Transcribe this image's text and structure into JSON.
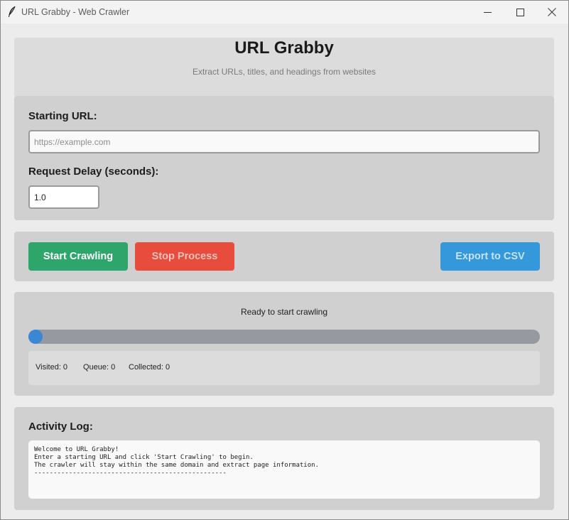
{
  "window": {
    "title": "URL Grabby - Web Crawler",
    "icon": "feather-icon"
  },
  "header": {
    "title": "URL Grabby",
    "subtitle": "Extract URLs, titles, and headings from websites"
  },
  "form": {
    "url_label": "Starting URL:",
    "url_placeholder": "https://example.com",
    "url_value": "",
    "delay_label": "Request Delay (seconds):",
    "delay_value": "1.0"
  },
  "actions": {
    "start_label": "Start Crawling",
    "stop_label": "Stop Process",
    "export_label": "Export to CSV"
  },
  "progress": {
    "status": "Ready to start crawling",
    "value": 0,
    "visited": "Visited: 0",
    "queue": "Queue: 0",
    "collected": "Collected: 0"
  },
  "log": {
    "label": "Activity Log:",
    "lines": [
      "Welcome to URL Grabby!",
      "Enter a starting URL and click 'Start Crawling' to begin.",
      "The crawler will stay within the same domain and extract page information.",
      "--------------------------------------------------"
    ]
  },
  "colors": {
    "start": "#2ea66b",
    "stop": "#e74c3c",
    "export": "#3498db",
    "progress_fill": "#3a87d4"
  }
}
